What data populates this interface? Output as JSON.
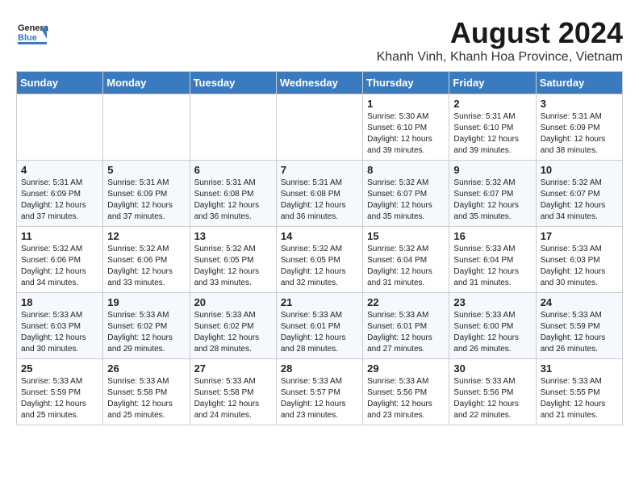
{
  "header": {
    "logo_general": "General",
    "logo_blue": "Blue",
    "title": "August 2024",
    "subtitle": "Khanh Vinh, Khanh Hoa Province, Vietnam"
  },
  "weekdays": [
    "Sunday",
    "Monday",
    "Tuesday",
    "Wednesday",
    "Thursday",
    "Friday",
    "Saturday"
  ],
  "weeks": [
    [
      {
        "day": "",
        "info": ""
      },
      {
        "day": "",
        "info": ""
      },
      {
        "day": "",
        "info": ""
      },
      {
        "day": "",
        "info": ""
      },
      {
        "day": "1",
        "info": "Sunrise: 5:30 AM\nSunset: 6:10 PM\nDaylight: 12 hours\nand 39 minutes."
      },
      {
        "day": "2",
        "info": "Sunrise: 5:31 AM\nSunset: 6:10 PM\nDaylight: 12 hours\nand 39 minutes."
      },
      {
        "day": "3",
        "info": "Sunrise: 5:31 AM\nSunset: 6:09 PM\nDaylight: 12 hours\nand 38 minutes."
      }
    ],
    [
      {
        "day": "4",
        "info": "Sunrise: 5:31 AM\nSunset: 6:09 PM\nDaylight: 12 hours\nand 37 minutes."
      },
      {
        "day": "5",
        "info": "Sunrise: 5:31 AM\nSunset: 6:09 PM\nDaylight: 12 hours\nand 37 minutes."
      },
      {
        "day": "6",
        "info": "Sunrise: 5:31 AM\nSunset: 6:08 PM\nDaylight: 12 hours\nand 36 minutes."
      },
      {
        "day": "7",
        "info": "Sunrise: 5:31 AM\nSunset: 6:08 PM\nDaylight: 12 hours\nand 36 minutes."
      },
      {
        "day": "8",
        "info": "Sunrise: 5:32 AM\nSunset: 6:07 PM\nDaylight: 12 hours\nand 35 minutes."
      },
      {
        "day": "9",
        "info": "Sunrise: 5:32 AM\nSunset: 6:07 PM\nDaylight: 12 hours\nand 35 minutes."
      },
      {
        "day": "10",
        "info": "Sunrise: 5:32 AM\nSunset: 6:07 PM\nDaylight: 12 hours\nand 34 minutes."
      }
    ],
    [
      {
        "day": "11",
        "info": "Sunrise: 5:32 AM\nSunset: 6:06 PM\nDaylight: 12 hours\nand 34 minutes."
      },
      {
        "day": "12",
        "info": "Sunrise: 5:32 AM\nSunset: 6:06 PM\nDaylight: 12 hours\nand 33 minutes."
      },
      {
        "day": "13",
        "info": "Sunrise: 5:32 AM\nSunset: 6:05 PM\nDaylight: 12 hours\nand 33 minutes."
      },
      {
        "day": "14",
        "info": "Sunrise: 5:32 AM\nSunset: 6:05 PM\nDaylight: 12 hours\nand 32 minutes."
      },
      {
        "day": "15",
        "info": "Sunrise: 5:32 AM\nSunset: 6:04 PM\nDaylight: 12 hours\nand 31 minutes."
      },
      {
        "day": "16",
        "info": "Sunrise: 5:33 AM\nSunset: 6:04 PM\nDaylight: 12 hours\nand 31 minutes."
      },
      {
        "day": "17",
        "info": "Sunrise: 5:33 AM\nSunset: 6:03 PM\nDaylight: 12 hours\nand 30 minutes."
      }
    ],
    [
      {
        "day": "18",
        "info": "Sunrise: 5:33 AM\nSunset: 6:03 PM\nDaylight: 12 hours\nand 30 minutes."
      },
      {
        "day": "19",
        "info": "Sunrise: 5:33 AM\nSunset: 6:02 PM\nDaylight: 12 hours\nand 29 minutes."
      },
      {
        "day": "20",
        "info": "Sunrise: 5:33 AM\nSunset: 6:02 PM\nDaylight: 12 hours\nand 28 minutes."
      },
      {
        "day": "21",
        "info": "Sunrise: 5:33 AM\nSunset: 6:01 PM\nDaylight: 12 hours\nand 28 minutes."
      },
      {
        "day": "22",
        "info": "Sunrise: 5:33 AM\nSunset: 6:01 PM\nDaylight: 12 hours\nand 27 minutes."
      },
      {
        "day": "23",
        "info": "Sunrise: 5:33 AM\nSunset: 6:00 PM\nDaylight: 12 hours\nand 26 minutes."
      },
      {
        "day": "24",
        "info": "Sunrise: 5:33 AM\nSunset: 5:59 PM\nDaylight: 12 hours\nand 26 minutes."
      }
    ],
    [
      {
        "day": "25",
        "info": "Sunrise: 5:33 AM\nSunset: 5:59 PM\nDaylight: 12 hours\nand 25 minutes."
      },
      {
        "day": "26",
        "info": "Sunrise: 5:33 AM\nSunset: 5:58 PM\nDaylight: 12 hours\nand 25 minutes."
      },
      {
        "day": "27",
        "info": "Sunrise: 5:33 AM\nSunset: 5:58 PM\nDaylight: 12 hours\nand 24 minutes."
      },
      {
        "day": "28",
        "info": "Sunrise: 5:33 AM\nSunset: 5:57 PM\nDaylight: 12 hours\nand 23 minutes."
      },
      {
        "day": "29",
        "info": "Sunrise: 5:33 AM\nSunset: 5:56 PM\nDaylight: 12 hours\nand 23 minutes."
      },
      {
        "day": "30",
        "info": "Sunrise: 5:33 AM\nSunset: 5:56 PM\nDaylight: 12 hours\nand 22 minutes."
      },
      {
        "day": "31",
        "info": "Sunrise: 5:33 AM\nSunset: 5:55 PM\nDaylight: 12 hours\nand 21 minutes."
      }
    ]
  ]
}
